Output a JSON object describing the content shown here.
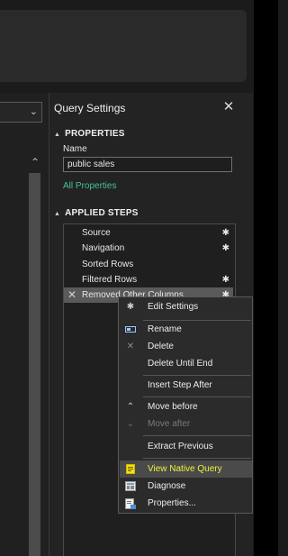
{
  "query_settings": {
    "title": "Query Settings",
    "properties_heading": "PROPERTIES",
    "name_label": "Name",
    "name_value": "public sales",
    "all_properties_link": "All Properties",
    "applied_steps_heading": "APPLIED STEPS",
    "steps": [
      {
        "label": "Source",
        "has_gear": true
      },
      {
        "label": "Navigation",
        "has_gear": true
      },
      {
        "label": "Sorted Rows",
        "has_gear": false
      },
      {
        "label": "Filtered Rows",
        "has_gear": true
      },
      {
        "label": "Removed Other Columns",
        "has_gear": true,
        "selected": true
      }
    ]
  },
  "context_menu": {
    "items": [
      {
        "label": "Edit Settings",
        "icon": "gear-icon"
      },
      {
        "label": "Rename",
        "icon": "rename-icon"
      },
      {
        "label": "Delete",
        "icon": "delete-icon"
      },
      {
        "label": "Delete Until End",
        "icon": ""
      },
      {
        "label": "Insert Step After",
        "icon": ""
      },
      {
        "label": "Move before",
        "icon": "chevron-up-icon"
      },
      {
        "label": "Move after",
        "icon": "chevron-down-icon",
        "disabled": true
      },
      {
        "label": "Extract Previous",
        "icon": ""
      },
      {
        "label": "View Native Query",
        "icon": "native-query-icon",
        "highlighted": true
      },
      {
        "label": "Diagnose",
        "icon": "diagnose-icon"
      },
      {
        "label": "Properties...",
        "icon": "properties-icon"
      }
    ]
  },
  "colors": {
    "link_green": "#46c38f",
    "highlight_yellow": "#f2f23a",
    "background": "#1b1b1b"
  }
}
